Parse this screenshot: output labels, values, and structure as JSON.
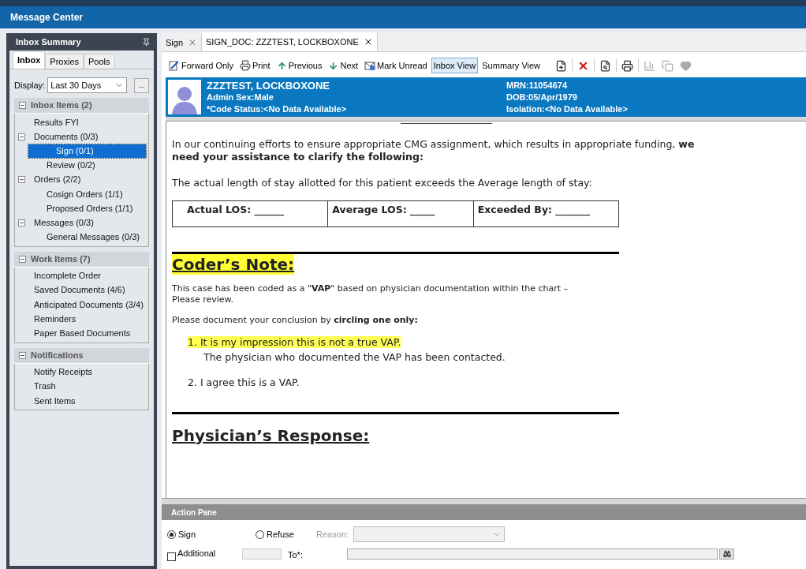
{
  "window": {
    "title": "Message Center"
  },
  "inbox_summary": {
    "title": "Inbox Summary",
    "tabs": [
      {
        "label": "Inbox",
        "selected": true
      },
      {
        "label": "Proxies",
        "selected": false
      },
      {
        "label": "Pools",
        "selected": false
      }
    ],
    "display": {
      "label": "Display:",
      "value": "Last 30 Days",
      "more": "..."
    },
    "sections": [
      {
        "title": "Inbox Items (2)",
        "expanded": true,
        "items": [
          {
            "label": "Results FYI",
            "selected": false
          },
          {
            "label": "Documents (0/3)",
            "selected": false,
            "expanded": true,
            "children": [
              {
                "label": "Sign (0/1)",
                "selected": true
              },
              {
                "label": "Review (0/2)",
                "selected": false
              }
            ]
          },
          {
            "label": "Orders (2/2)",
            "selected": false,
            "expanded": true,
            "children": [
              {
                "label": "Cosign Orders (1/1)",
                "selected": false
              },
              {
                "label": "Proposed Orders (1/1)",
                "selected": false
              }
            ]
          },
          {
            "label": "Messages (0/3)",
            "selected": false,
            "expanded": true,
            "children": [
              {
                "label": "General Messages (0/3)",
                "selected": false
              }
            ]
          }
        ]
      },
      {
        "title": "Work Items (7)",
        "expanded": true,
        "items": [
          {
            "label": "Incomplete Order",
            "selected": false
          },
          {
            "label": "Saved Documents (4/6)",
            "selected": false
          },
          {
            "label": "Anticipated Documents (3/4)",
            "selected": false
          },
          {
            "label": "Reminders",
            "selected": false
          },
          {
            "label": "Paper Based Documents",
            "selected": false
          }
        ]
      },
      {
        "title": "Notifications",
        "expanded": true,
        "items": [
          {
            "label": "Notify Receipts",
            "selected": false
          },
          {
            "label": "Trash",
            "selected": false
          },
          {
            "label": "Sent Items",
            "selected": false
          }
        ]
      }
    ]
  },
  "document_tabs": [
    {
      "label": "Sign",
      "selected": false
    },
    {
      "label": "SIGN_DOC: ZZZTEST, LOCKBOXONE",
      "selected": true
    }
  ],
  "toolbar": {
    "buttons": [
      {
        "label": "Forward Only",
        "kind": "forward",
        "selected": false
      },
      {
        "label": "Print",
        "kind": "print",
        "selected": false
      },
      {
        "label": "Previous",
        "kind": "previous",
        "selected": false
      },
      {
        "label": "Next",
        "kind": "next",
        "selected": false
      },
      {
        "label": "Mark Unread",
        "kind": "unread",
        "selected": false
      },
      {
        "label": "Inbox View",
        "kind": "text",
        "selected": true
      },
      {
        "label": "Summary View",
        "kind": "text",
        "selected": false
      }
    ],
    "icon_buttons": [
      {
        "kind": "new-document",
        "disabled": false
      },
      {
        "kind": "delete",
        "disabled": false
      },
      {
        "kind": "preview",
        "disabled": false
      },
      {
        "kind": "printer",
        "disabled": false
      },
      {
        "kind": "chart",
        "disabled": true
      },
      {
        "kind": "copy",
        "disabled": true
      },
      {
        "kind": "heart",
        "disabled": true
      }
    ]
  },
  "patient": {
    "name": "ZZZTEST, LOCKBOXONE",
    "details": [
      "Admin Sex:Male",
      "*Code Status:<No Data Available>"
    ],
    "ids": [
      "MRN:11054674",
      "DOB:05/Apr/1979",
      "Isolation:<No Data Available>"
    ]
  },
  "document": {
    "intro": "In our continuing efforts to ensure appropriate CMG assignment, which results in appropriate funding, **we need your assistance to clarify the following:**",
    "los_text": "The actual length of stay allotted for this patient exceeds the Average length of stay:",
    "los_cells": [
      "Actual LOS: ______",
      "Average LOS: _____",
      "Exceeded By: _______"
    ],
    "coder_heading": {
      "text": "Coder’s Note:",
      "highlighted": true
    },
    "case_text": "This case has been coded as a \"**VAP**\" based on physician documentation within the chart –\nPlease review.",
    "instruction": "Please document your conclusion by **circling one only:**",
    "options": [
      {
        "number": "1.",
        "text": "It is my impression this is not a true VAP.",
        "highlighted": true,
        "note": "The physician who documented the VAP has been contacted."
      },
      {
        "number": "2.",
        "text": "I agree this is a VAP.",
        "highlighted": false
      }
    ],
    "response_heading": {
      "text": "Physician’s Response:",
      "highlighted": false
    }
  },
  "action_pane": {
    "title": "Action Pane",
    "choices": [
      {
        "label": "Sign",
        "selected": true
      },
      {
        "label": "Refuse",
        "selected": false
      }
    ],
    "reason": {
      "label": "Reason:",
      "disabled": true
    },
    "additional": {
      "label": "Additional",
      "checked": false
    },
    "to": {
      "label": "To*:"
    }
  }
}
